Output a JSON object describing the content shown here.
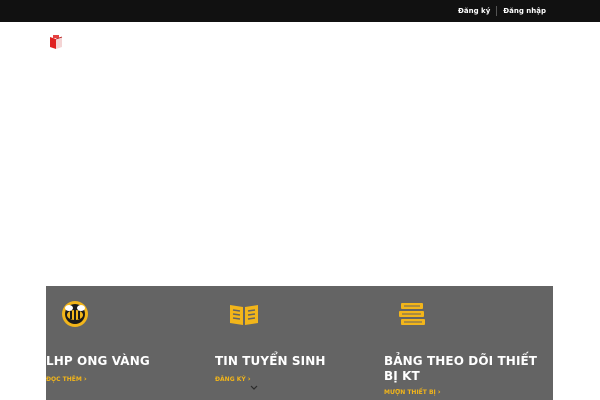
{
  "topbar": {
    "register_label": "Đăng ký",
    "login_label": "Đăng nhập"
  },
  "features": [
    {
      "title": "LHP ONG VÀNG",
      "link_label": "ĐỌC THÊM",
      "icon": "bee-badge-icon"
    },
    {
      "title": "TIN TUYỂN SINH",
      "link_label": "ĐĂNG KÝ",
      "icon": "open-book-icon"
    },
    {
      "title": "BẢNG THEO DÕI THIẾT BỊ KT",
      "link_label": "MƯỢN THIẾT BỊ",
      "icon": "book-stack-icon"
    }
  ],
  "colors": {
    "topbar": "#111111",
    "panel": "#646464",
    "accent": "#f2b51a",
    "logo_red": "#e02020"
  }
}
